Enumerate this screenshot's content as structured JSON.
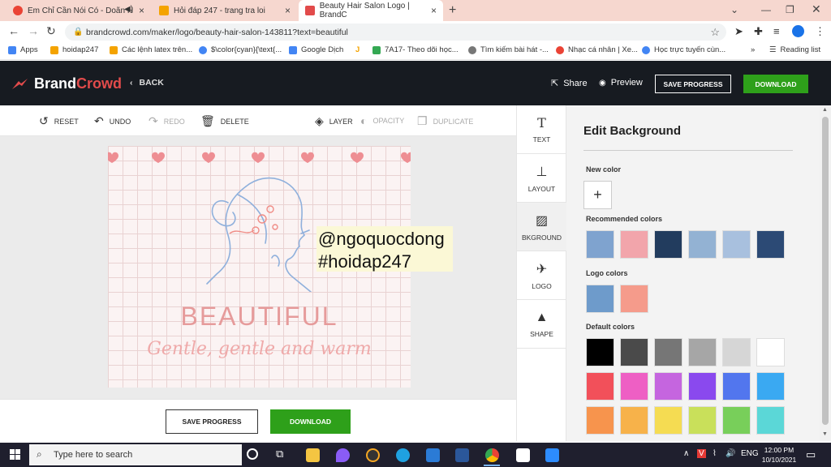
{
  "browser": {
    "tabs": [
      {
        "title": "Em Chỉ Cần Nói Có - Doãn H",
        "favicon_color": "#ea4335"
      },
      {
        "title": "Hỏi đáp 247 - trang tra loi",
        "favicon_color": "#f4a300"
      },
      {
        "title": "Beauty Hair Salon Logo | BrandC",
        "favicon_color": "#e24b4b"
      }
    ],
    "url": "brandcrowd.com/maker/logo/beauty-hair-salon-143811?text=beautiful",
    "bookmarks": [
      {
        "label": "Apps",
        "color": "#4285f4"
      },
      {
        "label": "hoidap247",
        "color": "#f4a300"
      },
      {
        "label": "Các lệnh latex trên...",
        "color": "#f4a300"
      },
      {
        "label": "$\\color{cyan}{\\text{...",
        "color": "#4285f4"
      },
      {
        "label": "Google Dịch",
        "color": "#4285f4"
      },
      {
        "label": "7A17- Theo dõi học...",
        "color": "#34a853"
      },
      {
        "label": "Tìm kiếm bài hát -...",
        "color": "#777777"
      },
      {
        "label": "Nhạc cá nhân | Xe...",
        "color": "#ea4335"
      },
      {
        "label": "Học trực tuyến cùn...",
        "color": "#4285f4"
      }
    ],
    "reading_list": "Reading list"
  },
  "header": {
    "brand_a": "Brand",
    "brand_b": "Crowd",
    "back": "BACK",
    "share": "Share",
    "preview": "Preview",
    "save": "SAVE PROGRESS",
    "download": "DOWNLOAD"
  },
  "toolbar": {
    "reset": "RESET",
    "undo": "UNDO",
    "redo": "REDO",
    "delete": "DELETE",
    "layer": "LAYER",
    "opacity": "OPACITY",
    "duplicate": "DUPLICATE"
  },
  "artboard": {
    "title": "BEAUTIFUL",
    "tagline": "Gentle, gentle and warm"
  },
  "watermark": {
    "line1": "@ngoquocdong",
    "line2": "#hoidap247"
  },
  "bottom": {
    "save": "SAVE PROGRESS",
    "download": "DOWNLOAD"
  },
  "side_tabs": [
    "TEXT",
    "LAYOUT",
    "BKGROUND",
    "LOGO",
    "SHAPE"
  ],
  "panel": {
    "title": "Edit Background",
    "new_color": "New color",
    "recommended_label": "Recommended colors",
    "recommended": [
      "#7fa3cf",
      "#f2a5ab",
      "#223c5e",
      "#93b2d3",
      "#a8c0de",
      "#2c4a75"
    ],
    "logo_label": "Logo colors",
    "logo": [
      "#6e9bcb",
      "#f59b8b"
    ],
    "default_label": "Default colors",
    "default_row1": [
      "#000000",
      "#4a4a4a",
      "#767676",
      "#a6a6a6",
      "#d6d6d6",
      "#ffffff"
    ],
    "default_row2": [
      "#f2505a",
      "#ee5fc4",
      "#c565df",
      "#8a49ee",
      "#5276ee",
      "#3aa9f2"
    ],
    "default_row3": [
      "#f7944d",
      "#f7b24a",
      "#f5dc52",
      "#c9e05a",
      "#78cf5a",
      "#5bd7d7"
    ]
  },
  "taskbar": {
    "search_placeholder": "Type here to search",
    "lang": "ENG",
    "time": "12:00 PM",
    "date": "10/10/2021"
  }
}
